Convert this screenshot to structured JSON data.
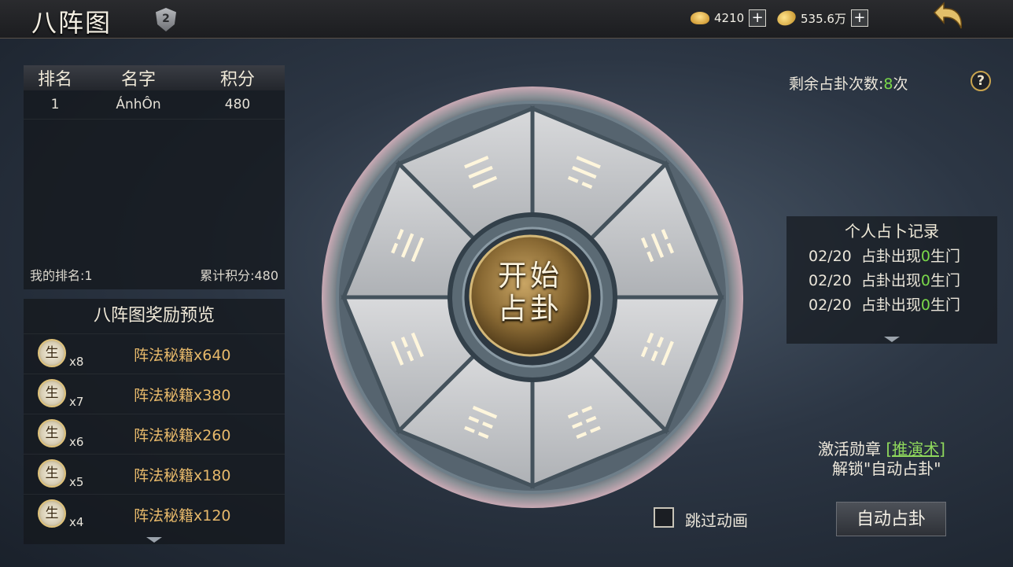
{
  "header": {
    "title": "八阵图",
    "rank_badge": "2",
    "currency_ingot": "4210",
    "currency_coin": "535.6万"
  },
  "ranking": {
    "col_rank": "排名",
    "col_name": "名字",
    "col_score": "积分",
    "rows": [
      {
        "rank": "1",
        "name": "ÁnhÔn",
        "score": "480"
      }
    ],
    "my_rank": "我的排名:1",
    "total_score": "累计积分:480"
  },
  "rewards": {
    "title": "八阵图奖励预览",
    "icon_char": "生",
    "items": [
      {
        "mult": "x8",
        "name": "阵法秘籍x640"
      },
      {
        "mult": "x7",
        "name": "阵法秘籍x380"
      },
      {
        "mult": "x6",
        "name": "阵法秘籍x260"
      },
      {
        "mult": "x5",
        "name": "阵法秘籍x180"
      },
      {
        "mult": "x4",
        "name": "阵法秘籍x120"
      }
    ]
  },
  "wheel": {
    "start_line1": "开始",
    "start_line2": "占卦",
    "trigrams": [
      "☰",
      "☴",
      "☵",
      "☶",
      "☷",
      "☳",
      "☲",
      "☱"
    ]
  },
  "remaining": {
    "label": "剩余占卦次数:",
    "count": "8",
    "unit": "次"
  },
  "records": {
    "title": "个人占卜记录",
    "lines": [
      {
        "date": "02/20",
        "pre": "占卦出现",
        "count": "0",
        "post": "生门"
      },
      {
        "date": "02/20",
        "pre": "占卦出现",
        "count": "0",
        "post": "生门"
      },
      {
        "date": "02/20",
        "pre": "占卦出现",
        "count": "0",
        "post": "生门"
      }
    ]
  },
  "unlock": {
    "pre": "激活勋章",
    "link": "[推演术]",
    "line2": "解锁\"自动占卦\""
  },
  "controls": {
    "skip_label": "跳过动画",
    "auto_label": "自动占卦"
  },
  "colors": {
    "highlight_green": "#7ad84a",
    "reward_gold": "#e6b86a"
  }
}
